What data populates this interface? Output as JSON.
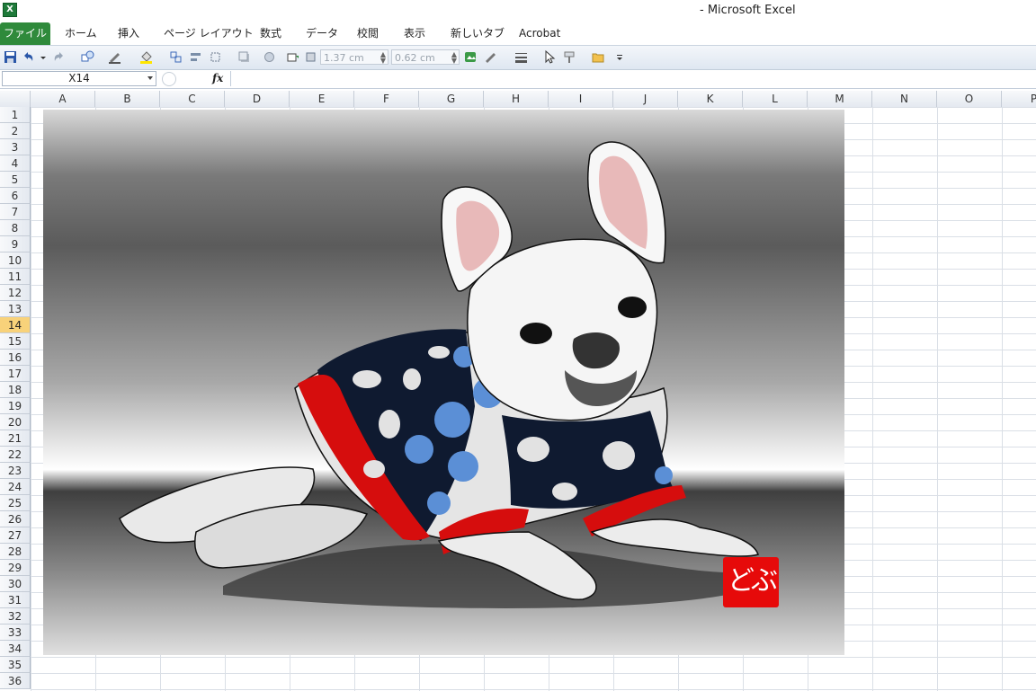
{
  "window": {
    "title": "- Microsoft Excel",
    "app_icon": "excel-icon"
  },
  "ribbon": {
    "tabs": [
      "ファイル",
      "ホーム",
      "挿入",
      "ページ レイアウト",
      "数式",
      "データ",
      "校閲",
      "表示",
      "新しいタブ",
      "Acrobat"
    ]
  },
  "toolbar": {
    "height_value": "1.37 cm",
    "width_value": "0.62 cm"
  },
  "formula_bar": {
    "name_box": "X14",
    "fx_label": "fx",
    "content": ""
  },
  "sheet": {
    "columns": [
      "A",
      "B",
      "C",
      "D",
      "E",
      "F",
      "G",
      "H",
      "I",
      "J",
      "K",
      "L",
      "M",
      "N",
      "O",
      "P"
    ],
    "rows": [
      "1",
      "2",
      "3",
      "4",
      "5",
      "6",
      "7",
      "8",
      "9",
      "10",
      "11",
      "12",
      "13",
      "14",
      "15",
      "16",
      "17",
      "18",
      "19",
      "20",
      "21",
      "22",
      "23",
      "24",
      "25",
      "26",
      "27",
      "28",
      "29",
      "30",
      "31",
      "32",
      "33",
      "34",
      "35",
      "36"
    ],
    "active_row": "14"
  },
  "picture": {
    "subject": "french-bulldog-illustration",
    "stamp_text": "どぶ"
  },
  "colors": {
    "file_tab": "#2f8a3b",
    "stamp_red": "#e60a0a",
    "active_row_header": "#f8d27a"
  }
}
